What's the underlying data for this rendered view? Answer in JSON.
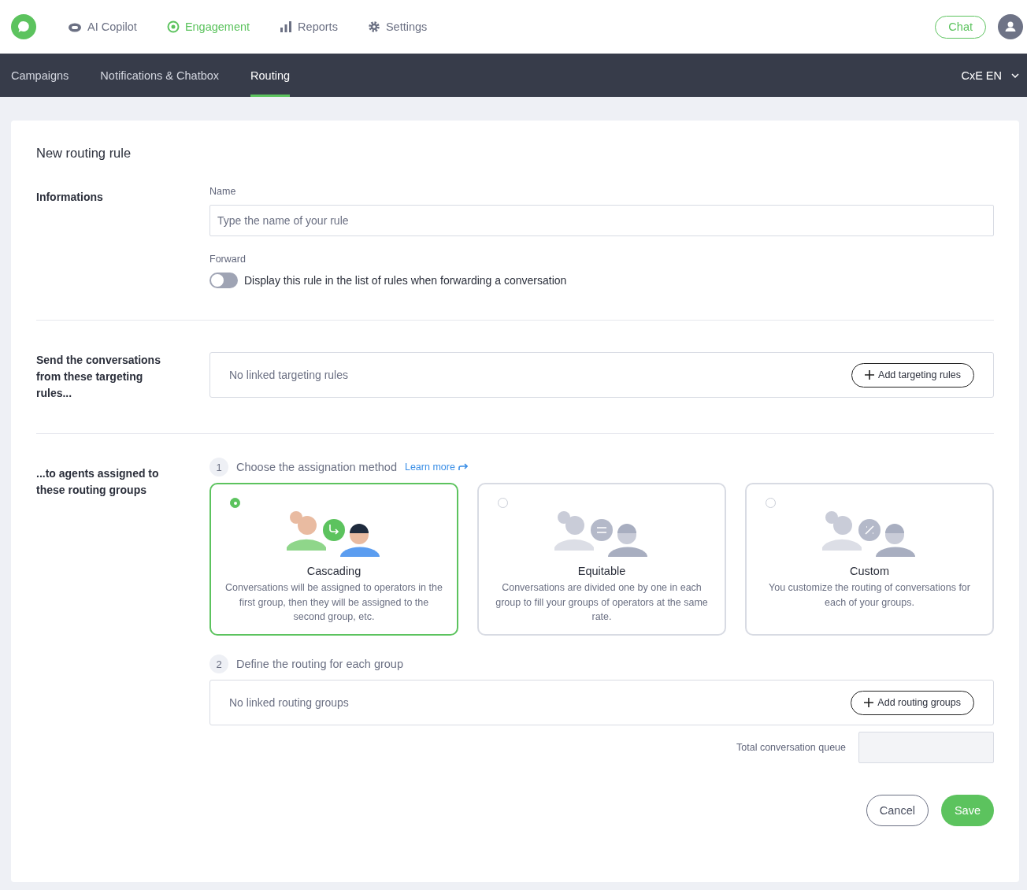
{
  "top_nav": {
    "items": [
      {
        "label": "AI Copilot",
        "selected": false
      },
      {
        "label": "Engagement",
        "selected": true
      },
      {
        "label": "Reports",
        "selected": false
      },
      {
        "label": "Settings",
        "selected": false
      }
    ],
    "chat_button": "Chat"
  },
  "sub_nav": {
    "tabs": [
      {
        "label": "Campaigns",
        "selected": false
      },
      {
        "label": "Notifications & Chatbox",
        "selected": false
      },
      {
        "label": "Routing",
        "selected": true
      }
    ],
    "workspace": "CxE EN"
  },
  "form": {
    "title": "New routing rule",
    "informations": {
      "heading": "Informations",
      "name_label": "Name",
      "name_placeholder": "Type the name of your rule",
      "forward_label": "Forward",
      "forward_toggle": {
        "on": false,
        "label": "Display this rule in the list of rules when forwarding a conversation"
      }
    },
    "targeting": {
      "heading": "Send the conversations from these targeting rules...",
      "empty": "No linked targeting rules",
      "button": "Add targeting rules"
    },
    "groups": {
      "heading": "...to agents assigned to these routing groups",
      "step1": {
        "number": "1",
        "label": "Choose the assignation method",
        "link": "Learn more"
      },
      "methods": [
        {
          "kind": "cascading",
          "title": "Cascading",
          "description": "Conversations will be assigned to operators in the first group, then they will be assigned to the second group, etc.",
          "selected": true
        },
        {
          "kind": "equitable",
          "title": "Equitable",
          "description": "Conversations are divided one by one in each group to fill your groups of operators at the same rate.",
          "selected": false
        },
        {
          "kind": "custom",
          "title": "Custom",
          "description": "You customize the routing of conversations for each of your groups.",
          "selected": false
        }
      ],
      "step2": {
        "number": "2",
        "label": "Define the routing for each group"
      },
      "empty": "No linked routing groups",
      "button": "Add routing groups",
      "queue_label": "Total conversation queue"
    },
    "buttons": {
      "cancel": "Cancel",
      "save": "Save"
    }
  }
}
